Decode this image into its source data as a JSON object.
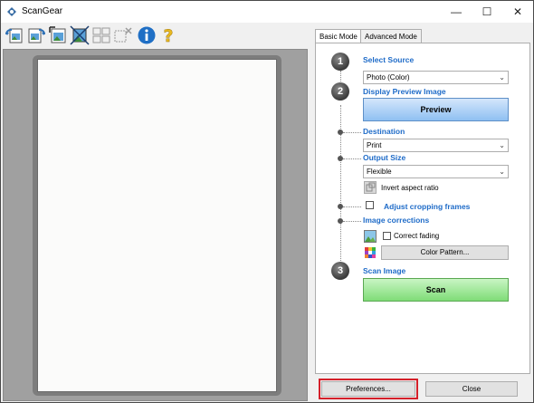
{
  "window": {
    "title": "ScanGear",
    "minimize_glyph": "—",
    "maximize_glyph": "☐",
    "close_glyph": "✕"
  },
  "toolbar": {
    "icons": [
      "rotate-left-icon",
      "rotate-right-icon",
      "auto-crop-icon",
      "invert-icon",
      "select-all-frames-icon",
      "remove-frame-icon",
      "info-icon",
      "help-icon"
    ]
  },
  "tabs": [
    {
      "label": "Basic Mode",
      "active": true
    },
    {
      "label": "Advanced Mode",
      "active": false
    }
  ],
  "steps": {
    "one": "1",
    "two": "2",
    "three": "3"
  },
  "select_source": {
    "heading": "Select Source",
    "value": "Photo (Color)"
  },
  "display_preview": {
    "heading": "Display Preview Image",
    "button": "Preview"
  },
  "destination": {
    "heading": "Destination",
    "value": "Print"
  },
  "output_size": {
    "heading": "Output Size",
    "value": "Flexible",
    "invert_aspect": "Invert aspect ratio"
  },
  "adjust_frames": {
    "label": "Adjust cropping frames",
    "checked": false
  },
  "image_corrections": {
    "heading": "Image corrections",
    "correct_fading": "Correct fading",
    "correct_fading_checked": false,
    "color_pattern": "Color Pattern..."
  },
  "scan_image": {
    "heading": "Scan Image",
    "button": "Scan"
  },
  "footer": {
    "preferences": "Preferences...",
    "close": "Close"
  },
  "colors": {
    "accent_heading": "#1e6bc8",
    "highlight": "#d4202a",
    "preview_bg": "#a0a0a0"
  }
}
